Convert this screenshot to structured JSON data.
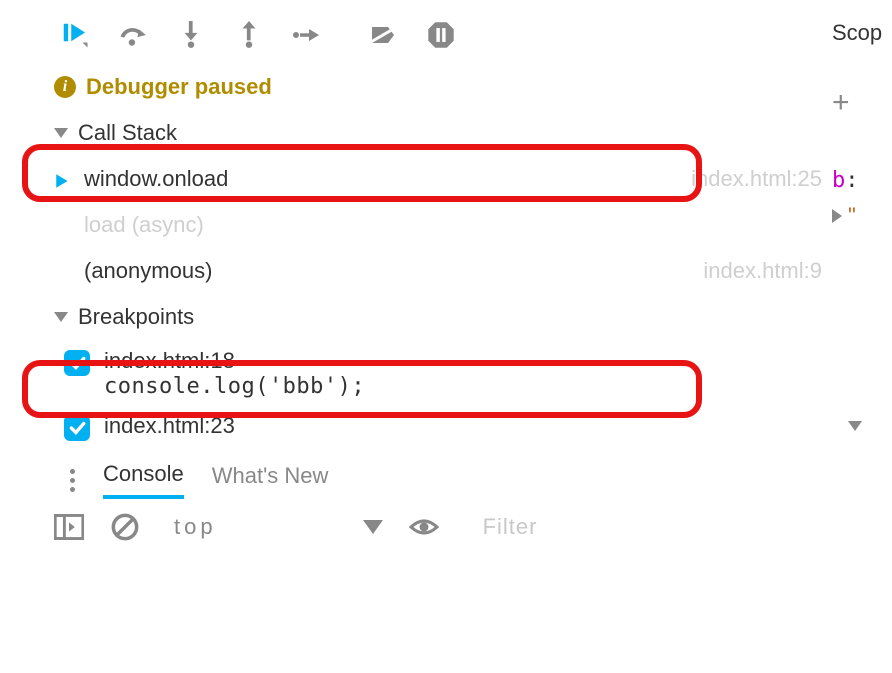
{
  "status": {
    "text": "Debugger paused"
  },
  "sections": {
    "callStack": "Call Stack",
    "breakpoints": "Breakpoints"
  },
  "callStack": [
    {
      "name": "window.onload",
      "loc": "index.html:25",
      "current": true,
      "dim": false
    },
    {
      "name": "load (async)",
      "loc": "",
      "current": false,
      "dim": true
    },
    {
      "name": "(anonymous)",
      "loc": "index.html:9",
      "current": false,
      "dim": false
    }
  ],
  "breakpoints": [
    {
      "loc": "index.html:18",
      "code": "console.log('bbb');",
      "checked": true
    },
    {
      "loc": "index.html:23",
      "code": "",
      "checked": true
    }
  ],
  "tabs": {
    "console": "Console",
    "whatsNew": "What's New"
  },
  "bottom": {
    "context": "top",
    "filter": "Filter"
  },
  "right": {
    "scope": "Scop",
    "var": "b",
    "colon": ":",
    "quote": "\""
  }
}
